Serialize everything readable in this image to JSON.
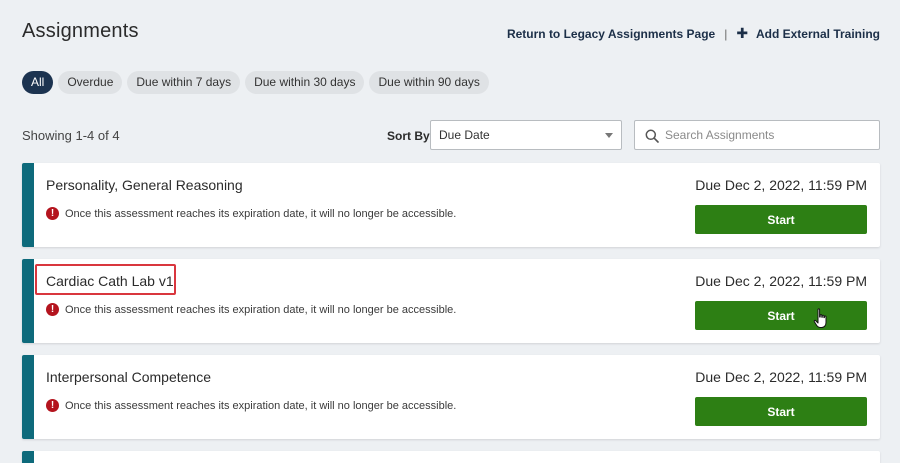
{
  "header": {
    "title": "Assignments",
    "legacy_link": "Return to Legacy Assignments Page",
    "separator": "|",
    "add_link": "Add External Training"
  },
  "filters": [
    {
      "label": "All",
      "active": true
    },
    {
      "label": "Overdue",
      "active": false
    },
    {
      "label": "Due within 7 days",
      "active": false
    },
    {
      "label": "Due within 30 days",
      "active": false
    },
    {
      "label": "Due within 90 days",
      "active": false
    }
  ],
  "toolbar": {
    "showing": "Showing 1-4 of 4",
    "sort_label": "Sort By",
    "sort_value": "Due Date",
    "search_placeholder": "Search Assignments"
  },
  "assignments": [
    {
      "title": "Personality, General Reasoning",
      "due": "Due Dec 2, 2022, 11:59 PM",
      "warning": "Once this assessment reaches its expiration date, it will no longer be accessible.",
      "button": "Start"
    },
    {
      "title": "Cardiac Cath Lab v1",
      "due": "Due Dec 2, 2022, 11:59 PM",
      "warning": "Once this assessment reaches its expiration date, it will no longer be accessible.",
      "button": "Start"
    },
    {
      "title": "Interpersonal Competence",
      "due": "Due Dec 2, 2022, 11:59 PM",
      "warning": "Once this assessment reaches its expiration date, it will no longer be accessible.",
      "button": "Start"
    }
  ],
  "colors": {
    "accent": "#0e6a7b",
    "start_button": "#2d7f14",
    "active_pill": "#1c3350",
    "warning": "#b4141e",
    "highlight": "#d9363e"
  },
  "icons": {
    "plus": "plus-icon",
    "search": "search-icon",
    "warning": "warning-icon",
    "caret": "chevron-down-icon",
    "cursor": "hand-pointer-icon"
  }
}
